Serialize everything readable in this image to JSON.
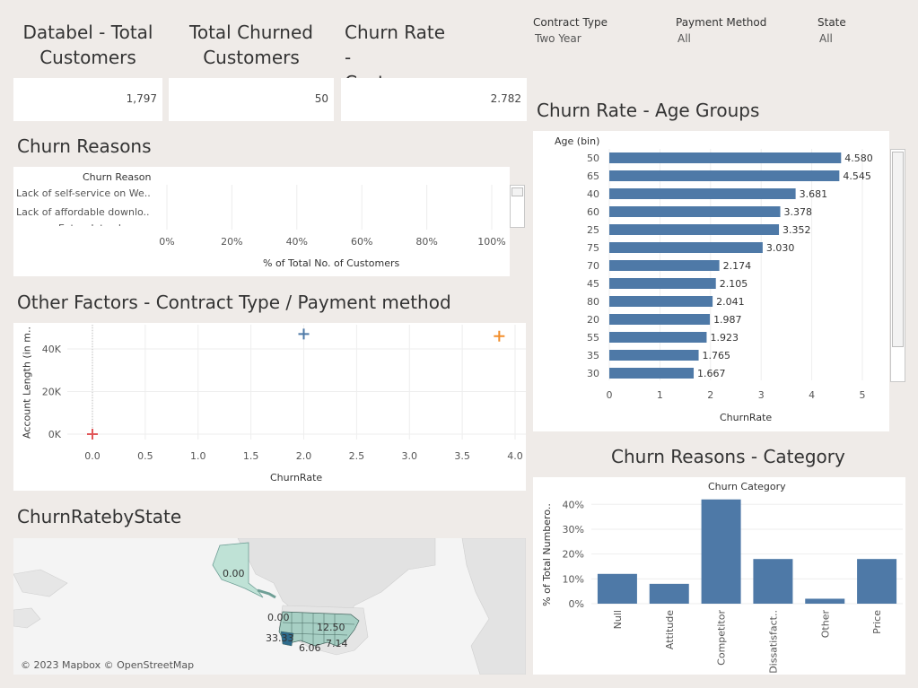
{
  "kpis": [
    {
      "title_line1": "Databel - Total",
      "title_line2": "Customers",
      "value": "1,797"
    },
    {
      "title_line1": "Total Churned",
      "title_line2": "Customers",
      "value": "50"
    },
    {
      "title_line1": "Churn Rate -",
      "title_line2": "Customers",
      "value": "2.782"
    }
  ],
  "filters": [
    {
      "label": "Contract Type",
      "value": "Two Year"
    },
    {
      "label": "Payment Method",
      "value": "All"
    },
    {
      "label": "State",
      "value": "All"
    }
  ],
  "sections": {
    "churn_reasons": "Churn Reasons",
    "other_factors": "Other Factors - Contract Type / Payment method",
    "churn_by_state": "ChurnRatebyState",
    "age_groups": "Churn Rate - Age Groups",
    "reason_category": "Churn Reasons - Category"
  },
  "colors": {
    "bar": "#4e79a7",
    "cross_red": "#e15759",
    "cross_blue": "#4e79a7",
    "cross_orange": "#f28e2b",
    "map_state": "#a7cfc4"
  },
  "map": {
    "attribution": "© 2023 Mapbox © OpenStreetMap",
    "labels": [
      "0.00",
      "0.00",
      "12.50",
      "33.33",
      "6.06",
      "7.14"
    ]
  },
  "chart_data": [
    {
      "type": "bar",
      "orientation": "horizontal",
      "title": "Churn Reasons",
      "row_header": "Churn Reason",
      "categories": [
        "Lack of self-service on We..",
        "Lack of affordable downlo..",
        "Extra data charges"
      ],
      "values": [],
      "xlabel": "% of Total No. of Customers",
      "x_ticks": [
        "0%",
        "20%",
        "40%",
        "60%",
        "80%",
        "100%"
      ],
      "xlim": [
        0,
        100
      ]
    },
    {
      "type": "scatter",
      "title": "Other Factors - Contract Type / Payment method",
      "xlabel": "ChurnRate",
      "ylabel": "Account Length (in m..",
      "x_ticks": [
        "0.0",
        "0.5",
        "1.0",
        "1.5",
        "2.0",
        "2.5",
        "3.0",
        "3.5",
        "4.0"
      ],
      "y_ticks": [
        "0K",
        "20K",
        "40K"
      ],
      "xlim": [
        0,
        4
      ],
      "ylim": [
        0,
        48000
      ],
      "points": [
        {
          "x": 0.0,
          "y": 0,
          "color": "#e15759"
        },
        {
          "x": 2.0,
          "y": 47000,
          "color": "#4e79a7"
        },
        {
          "x": 3.85,
          "y": 46000,
          "color": "#f28e2b"
        }
      ]
    },
    {
      "type": "bar",
      "orientation": "horizontal",
      "title": "Churn Rate - Age Groups",
      "row_header": "Age (bin)",
      "categories": [
        "50",
        "65",
        "40",
        "60",
        "25",
        "75",
        "70",
        "45",
        "80",
        "20",
        "55",
        "35",
        "30"
      ],
      "values": [
        4.58,
        4.545,
        3.681,
        3.378,
        3.352,
        3.03,
        2.174,
        2.105,
        2.041,
        1.987,
        1.923,
        1.765,
        1.667
      ],
      "value_labels": [
        "4.580",
        "4.545",
        "3.681",
        "3.378",
        "3.352",
        "3.030",
        "2.174",
        "2.105",
        "2.041",
        "1.987",
        "1.923",
        "1.765",
        "1.667"
      ],
      "xlabel": "ChurnRate",
      "x_ticks": [
        "0",
        "1",
        "2",
        "3",
        "4",
        "5"
      ],
      "xlim": [
        0,
        5.3
      ]
    },
    {
      "type": "bar",
      "title": "Churn Reasons - Category",
      "header": "Churn Category",
      "categories": [
        "Null",
        "Attitude",
        "Competitor",
        "Dissatisfact..",
        "Other",
        "Price"
      ],
      "values": [
        12,
        8,
        42,
        18,
        2,
        18
      ],
      "ylabel": "% of Total Numbero..",
      "y_ticks": [
        "0%",
        "10%",
        "20%",
        "30%",
        "40%"
      ],
      "ylim": [
        0,
        43
      ]
    }
  ]
}
